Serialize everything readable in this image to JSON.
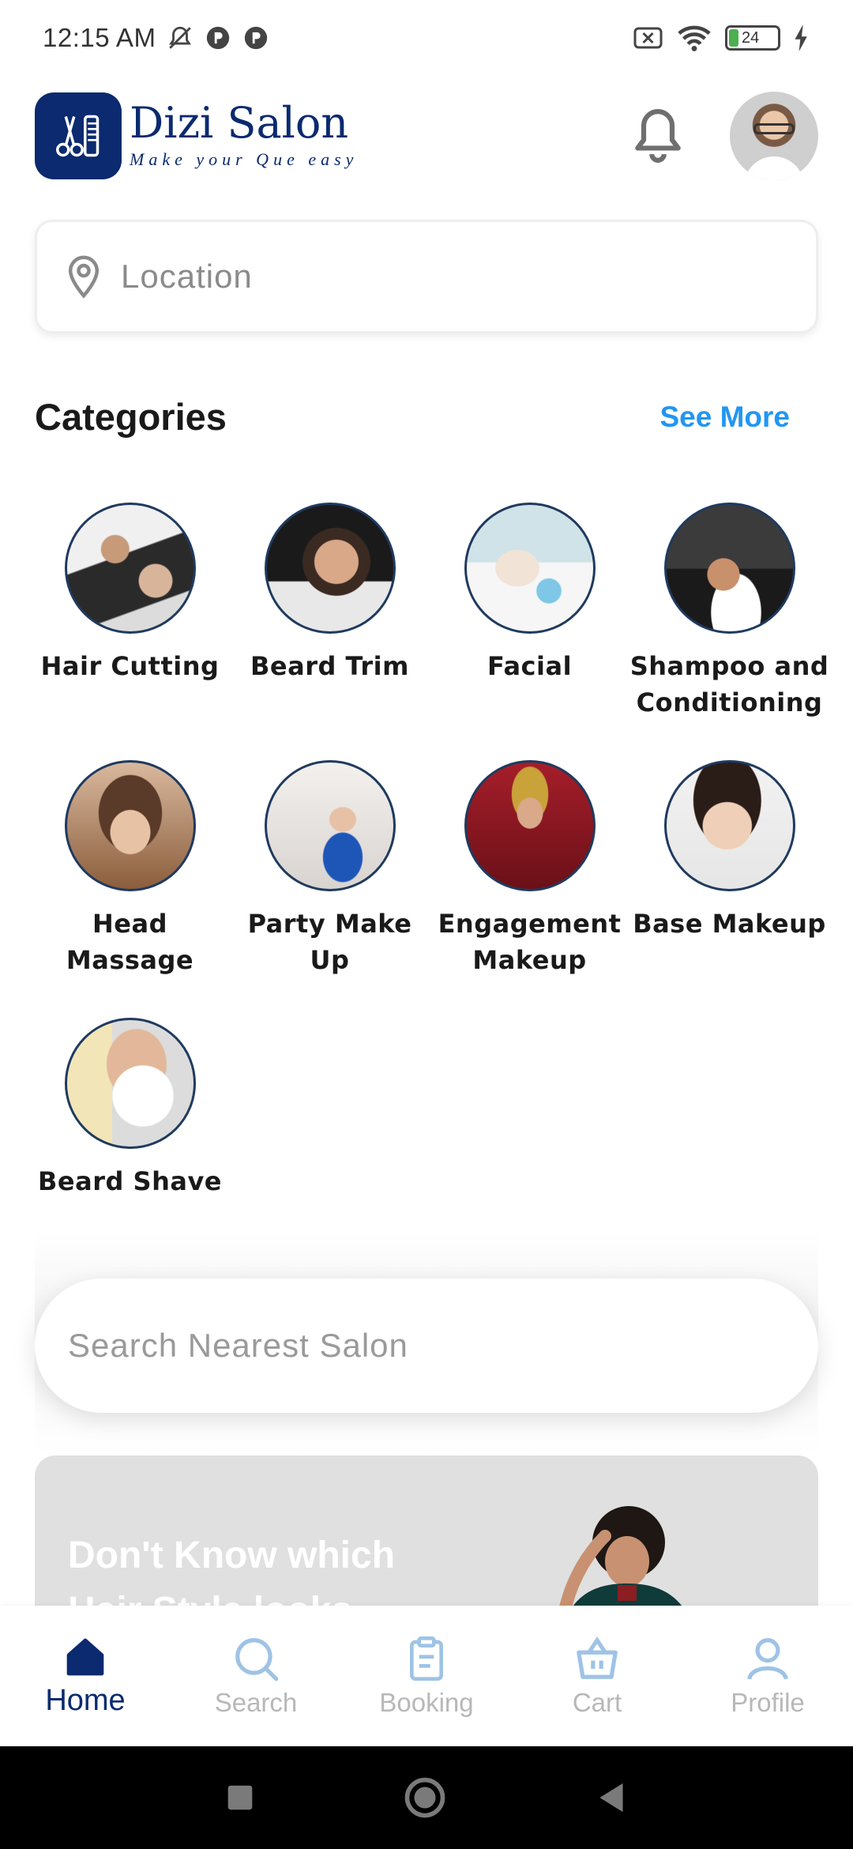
{
  "status_bar": {
    "time": "12:15 AM",
    "battery": "24"
  },
  "header": {
    "brand_name": "Dizi Salon",
    "tagline": "Make your Que easy"
  },
  "location": {
    "placeholder": "Location"
  },
  "categories": {
    "title": "Categories",
    "see_more": "See More",
    "items": [
      {
        "label": "Hair Cutting"
      },
      {
        "label": "Beard Trim"
      },
      {
        "label": "Facial"
      },
      {
        "label": "Shampoo and Conditioning"
      },
      {
        "label": "Head Massage"
      },
      {
        "label": "Party Make Up"
      },
      {
        "label": "Engagement Makeup"
      },
      {
        "label": "Base Makeup"
      },
      {
        "label": "Beard Shave"
      }
    ]
  },
  "search": {
    "placeholder": "Search Nearest Salon"
  },
  "promo": {
    "text": "Don't Know which Hair Style looks"
  },
  "bottom_nav": {
    "items": [
      {
        "label": "Home",
        "active": true
      },
      {
        "label": "Search"
      },
      {
        "label": "Booking"
      },
      {
        "label": "Cart"
      },
      {
        "label": "Profile"
      }
    ]
  },
  "colors": {
    "brand": "#0b2a6f",
    "accent": "#2196f3",
    "inactive": "#b8b8b8"
  }
}
